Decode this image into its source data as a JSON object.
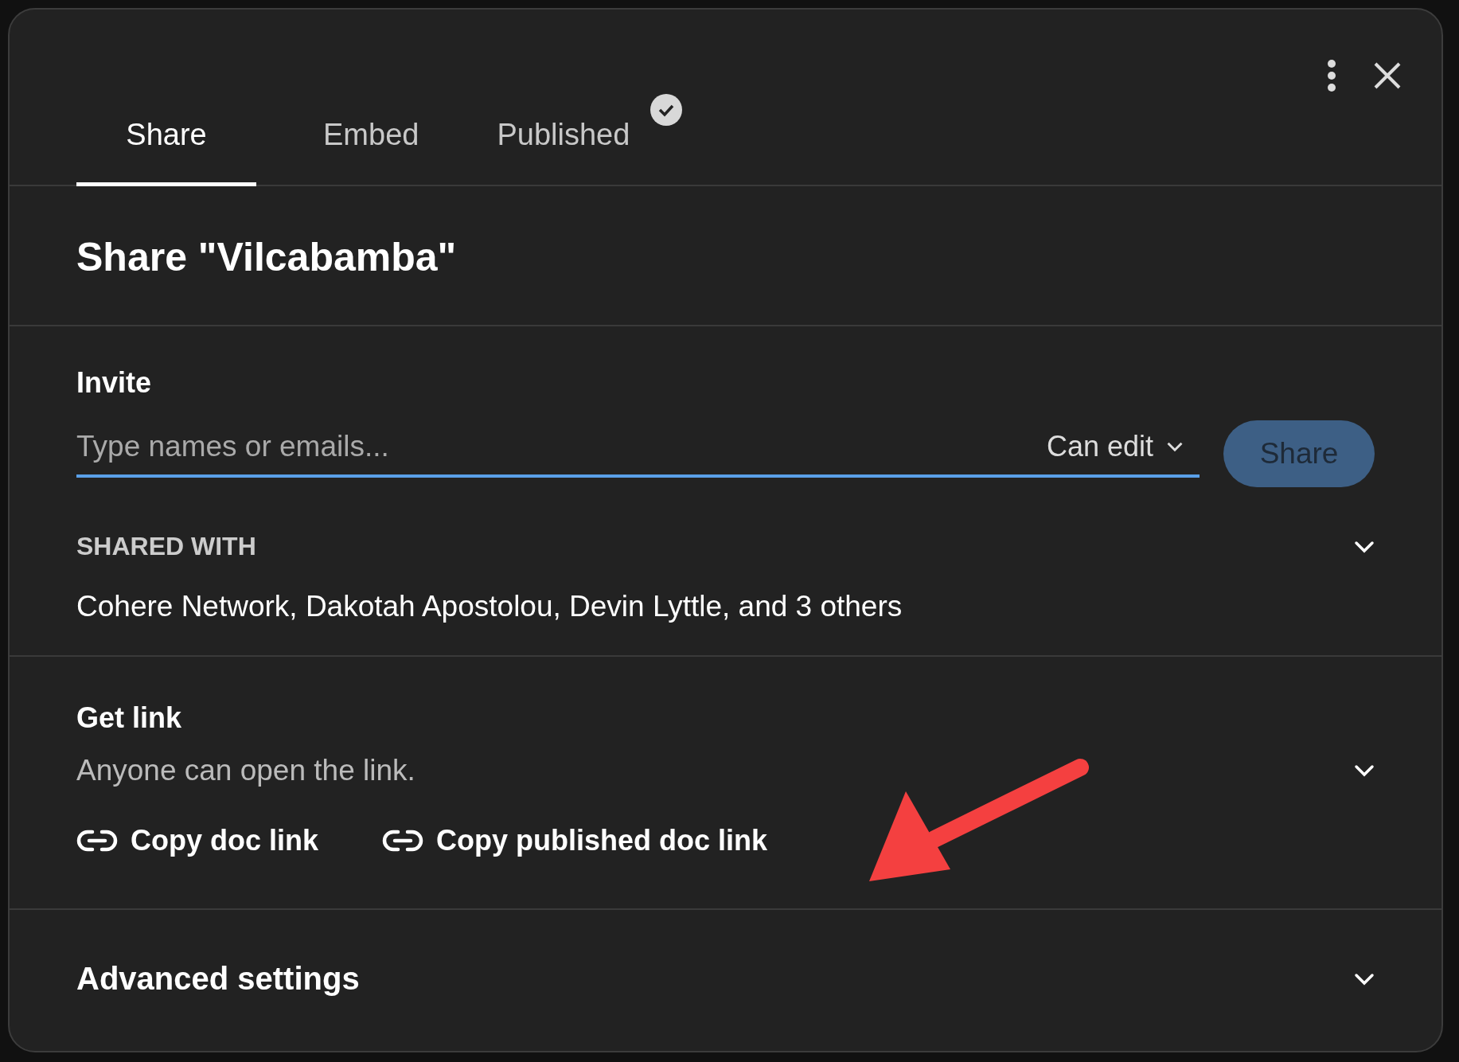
{
  "tabs": [
    {
      "label": "Share",
      "selected": true,
      "published_check": false
    },
    {
      "label": "Embed",
      "selected": false,
      "published_check": false
    },
    {
      "label": "Published",
      "selected": false,
      "published_check": true
    }
  ],
  "title": "Share \"Vilcabamba\"",
  "invite": {
    "label": "Invite",
    "placeholder": "Type names or emails...",
    "permission": "Can edit",
    "button": "Share"
  },
  "shared_with": {
    "label": "SHARED WITH",
    "names": "Cohere Network, Dakotah Apostolou, Devin Lyttle, and 3 others"
  },
  "get_link": {
    "label": "Get link",
    "description": "Anyone can open the link.",
    "links": [
      "Copy doc link",
      "Copy published doc link"
    ]
  },
  "advanced": {
    "label": "Advanced settings"
  }
}
